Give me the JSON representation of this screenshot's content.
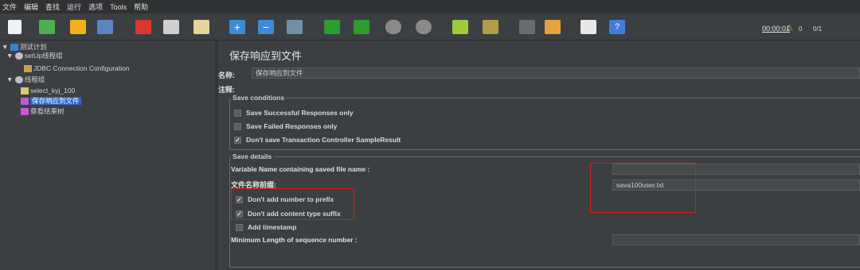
{
  "menu": [
    "文件",
    "编辑",
    "查找",
    "运行",
    "选项",
    "Tools",
    "帮助"
  ],
  "toolbar": {
    "timer": "00:00:01",
    "warning_count": "0",
    "thread_ratio": "0/1"
  },
  "tree": {
    "root": "测试计划",
    "setup_group": "setUp线程组",
    "jdbc_config": "JDBC Connection Configuration",
    "thread_group": "线程组",
    "sampler": "select_kyj_100",
    "save_to_file": "保存响应到文件",
    "results_tree": "察看结果树"
  },
  "panel": {
    "title": "保存响应到文件",
    "name_label": "名称:",
    "name_value": "保存响应到文件",
    "comment_label": "注释:",
    "save_conditions_legend": "Save conditions",
    "cb_successful": "Save Successful Responses only",
    "cb_failed": "Save Failed Responses only",
    "cb_transaction": "Don't save Transaction Controller SampleResult",
    "save_details_legend": "Save details",
    "var_name_label": "Variable Name containing saved file name :",
    "var_name_value": "",
    "prefix_label": "文件名称前缀:",
    "prefix_value": "sava100user.txt",
    "cb_no_number": "Don't add number to prefix",
    "cb_no_content_type": "Don't add content type suffix",
    "cb_timestamp": "Add timestamp",
    "min_length_label": "Minimum Length of sequence number :",
    "min_length_value": ""
  },
  "colors": {
    "background": "#3c3f41",
    "selection": "#2f65ca",
    "highlight_box": "#d01e1e"
  }
}
